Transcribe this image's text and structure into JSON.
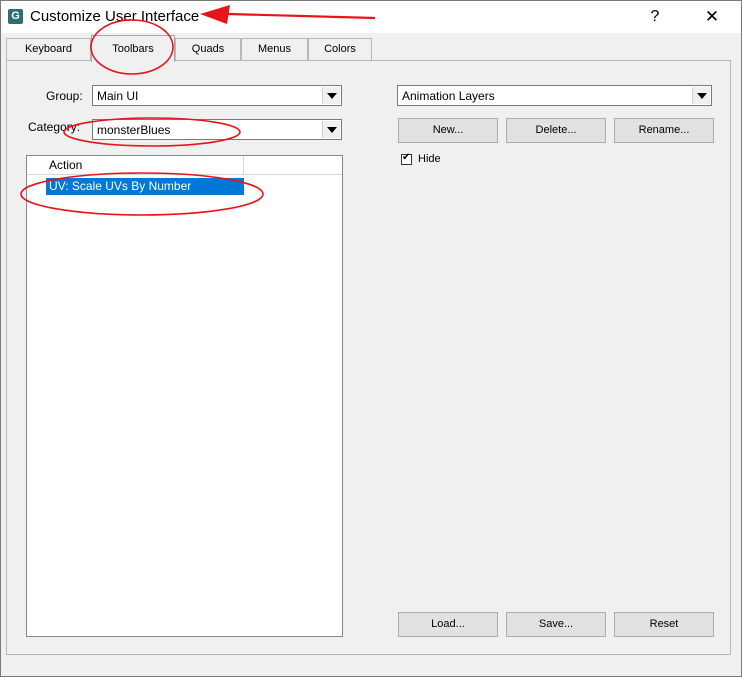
{
  "window": {
    "title": "Customize User Interface",
    "help_label": "?",
    "close_label": "✕"
  },
  "tabs": [
    {
      "label": "Keyboard"
    },
    {
      "label": "Toolbars",
      "active": true
    },
    {
      "label": "Quads"
    },
    {
      "label": "Menus"
    },
    {
      "label": "Colors"
    }
  ],
  "group": {
    "label": "Group:",
    "value": "Main UI"
  },
  "category": {
    "label": "Category:",
    "value": "monsterBlues"
  },
  "action_list": {
    "column_header": "Action",
    "selected_item": "UV: Scale UVs By Number"
  },
  "toolbar_select": {
    "value": "Animation Layers"
  },
  "toolbar_buttons": {
    "new": "New...",
    "delete": "Delete...",
    "rename": "Rename..."
  },
  "hide_checkbox": {
    "label": "Hide",
    "checked": true
  },
  "bottom_buttons": {
    "load": "Load...",
    "save": "Save...",
    "reset": "Reset"
  },
  "annotation_color": "#e8141b"
}
